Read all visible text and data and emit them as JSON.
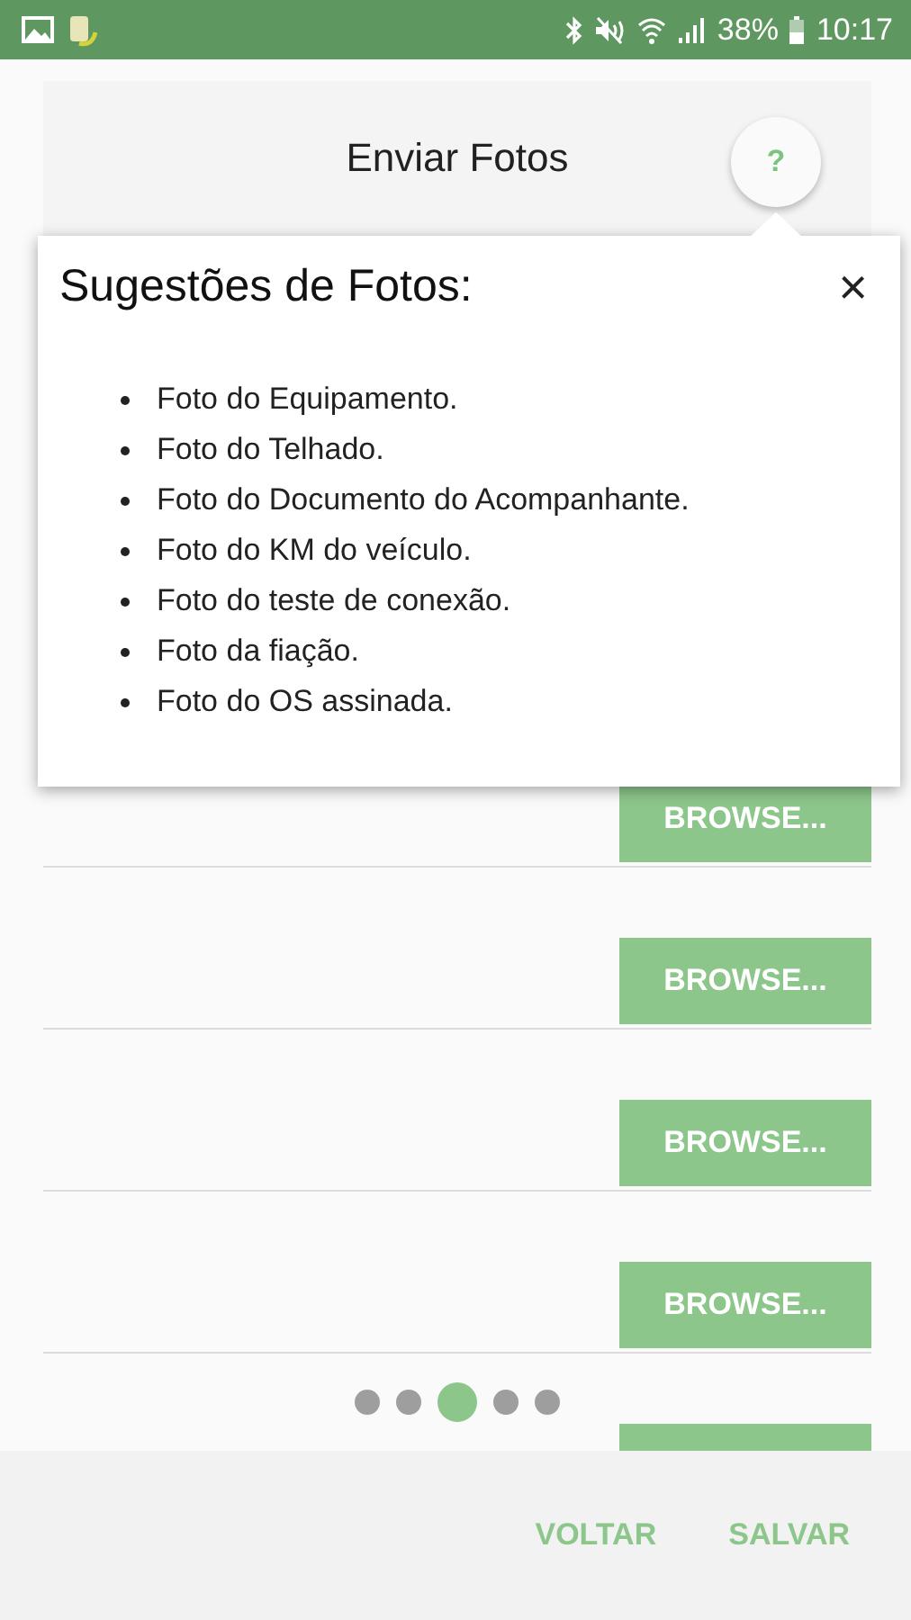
{
  "status_bar": {
    "battery": "38%",
    "time": "10:17"
  },
  "header": {
    "title": "Enviar Fotos",
    "help": "?"
  },
  "rows": [
    {
      "kind": "browse",
      "button": "BROWSE..."
    },
    {
      "kind": "browse",
      "button": "BROWSE..."
    },
    {
      "kind": "browse",
      "button": "BROWSE..."
    },
    {
      "kind": "browse",
      "button": "BROWSE..."
    },
    {
      "kind": "partial"
    }
  ],
  "pager": [
    {
      "selected": false
    },
    {
      "selected": false
    },
    {
      "selected": true
    },
    {
      "selected": false
    },
    {
      "selected": false
    }
  ],
  "popup": {
    "title": "Sugestões de Fotos:",
    "close": "×",
    "items": [
      "Foto do Equipamento.",
      "Foto do Telhado.",
      "Foto do Documento do Acompanhante.",
      "Foto do KM do veículo.",
      "Foto do teste de conexão.",
      "Foto da fiação.",
      "Foto do OS assinada."
    ]
  },
  "footer": {
    "buttons": [
      "VOLTAR",
      "SALVAR"
    ]
  }
}
